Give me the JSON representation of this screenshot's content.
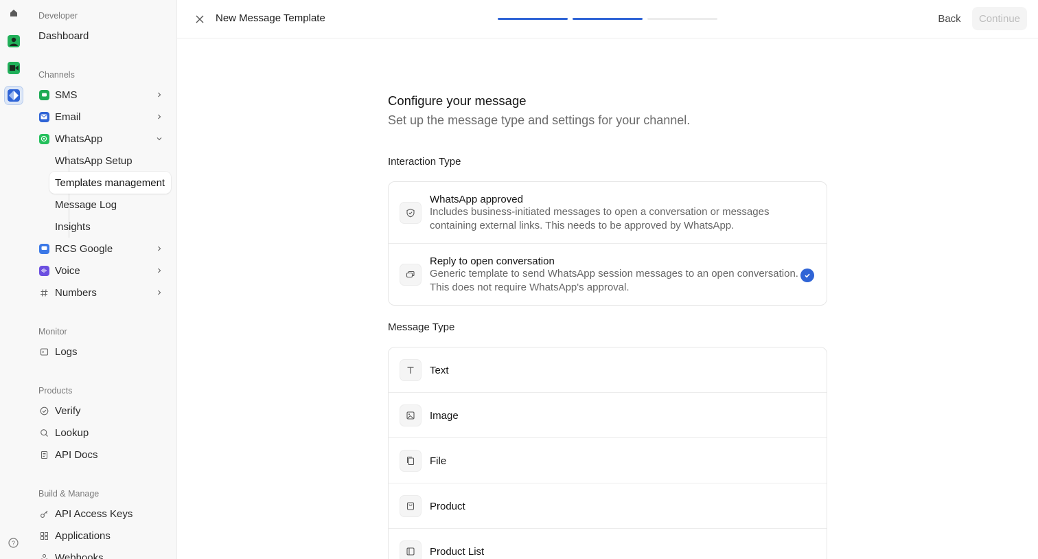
{
  "colors": {
    "accent": "#2f64d6",
    "sidebar_bg": "#f8f8f8",
    "whatsapp_green": "#25c05c",
    "sms_green": "#1faa55",
    "email_blue": "#2f64d6",
    "rcs_blue": "#3b78e7",
    "voice_purple": "#6b4fe0"
  },
  "sidebar": {
    "developer_label": "Developer",
    "dashboard": "Dashboard",
    "channels_label": "Channels",
    "channels": [
      {
        "label": "SMS",
        "icon": "sms-icon"
      },
      {
        "label": "Email",
        "icon": "email-icon"
      },
      {
        "label": "WhatsApp",
        "icon": "whatsapp-icon"
      },
      {
        "label": "RCS Google",
        "icon": "rcs-icon"
      },
      {
        "label": "Voice",
        "icon": "voice-icon"
      },
      {
        "label": "Numbers",
        "icon": "hash-icon"
      }
    ],
    "whatsapp_sub": [
      "WhatsApp Setup",
      "Templates management",
      "Message Log",
      "Insights"
    ],
    "monitor_label": "Monitor",
    "logs": "Logs",
    "products_label": "Products",
    "products": [
      "Verify",
      "Lookup",
      "API Docs"
    ],
    "build_label": "Build & Manage",
    "build": [
      "API Access Keys",
      "Applications",
      "Webhooks"
    ]
  },
  "header": {
    "title": "New Message Template",
    "steps_total": 3,
    "steps_completed": 2,
    "back": "Back",
    "continue": "Continue"
  },
  "main": {
    "heading": "Configure your message",
    "subheading": "Set up the message type and settings for your channel.",
    "interaction_label": "Interaction Type",
    "interaction_options": [
      {
        "title": "WhatsApp approved",
        "desc": "Includes business-initiated messages to open a conversation or messages containing external links. This needs to be approved by WhatsApp.",
        "selected": false,
        "icon": "shield-check-icon"
      },
      {
        "title": "Reply to open conversation",
        "desc": "Generic template to send WhatsApp session messages to an open conversation. This does not require WhatsApp's approval.",
        "selected": true,
        "icon": "chat-bubbles-icon"
      }
    ],
    "message_type_label": "Message Type",
    "message_types": [
      {
        "title": "Text",
        "icon": "text-icon"
      },
      {
        "title": "Image",
        "icon": "image-icon"
      },
      {
        "title": "File",
        "icon": "file-icon"
      },
      {
        "title": "Product",
        "icon": "product-icon"
      },
      {
        "title": "Product List",
        "icon": "product-list-icon"
      }
    ]
  }
}
